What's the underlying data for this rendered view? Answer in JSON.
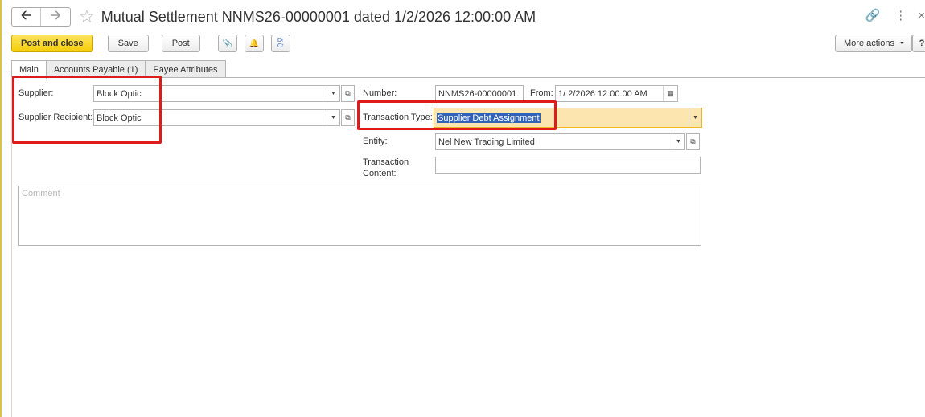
{
  "header": {
    "back_icon": "arrow-left-icon",
    "forward_icon": "arrow-right-icon",
    "favorite_icon": "star-icon",
    "title": "Mutual Settlement NNMS26-00000001 dated 1/2/2026 12:00:00 AM",
    "link_icon": "link-icon",
    "menu_icon": "vertical-dots-icon"
  },
  "toolbar": {
    "post_and_close": "Post and close",
    "save": "Save",
    "post": "Post",
    "attach_icon": "paperclip-icon",
    "notify_icon": "bell-icon",
    "dr_cr_label": "Dr Cr",
    "more_actions": "More actions",
    "help": "?"
  },
  "tabs": [
    {
      "label": "Main",
      "active": true
    },
    {
      "label": "Accounts Payable (1)",
      "active": false
    },
    {
      "label": "Payee Attributes",
      "active": false
    }
  ],
  "form": {
    "supplier": {
      "label": "Supplier:",
      "value": "Block Optic"
    },
    "supplier_recipient": {
      "label": "Supplier Recipient:",
      "value": "Block Optic"
    },
    "number": {
      "label": "Number:",
      "value": "NNMS26-00000001"
    },
    "from": {
      "label": "From:",
      "value": "1/ 2/2026 12:00:00 AM"
    },
    "transaction_type": {
      "label": "Transaction Type:",
      "value": "Supplier Debt Assignment"
    },
    "entity": {
      "label": "Entity:",
      "value": "Nel New Trading Limited"
    },
    "transaction_content": {
      "label_line1": "Transaction",
      "label_line2": "Content:",
      "value": ""
    },
    "comment": {
      "placeholder": "Comment"
    }
  },
  "colors": {
    "primary_button": "#f5cd0a",
    "highlight_box": "#e01b1b",
    "selection": "#3162b7",
    "active_field_bg": "#fde5b0"
  }
}
